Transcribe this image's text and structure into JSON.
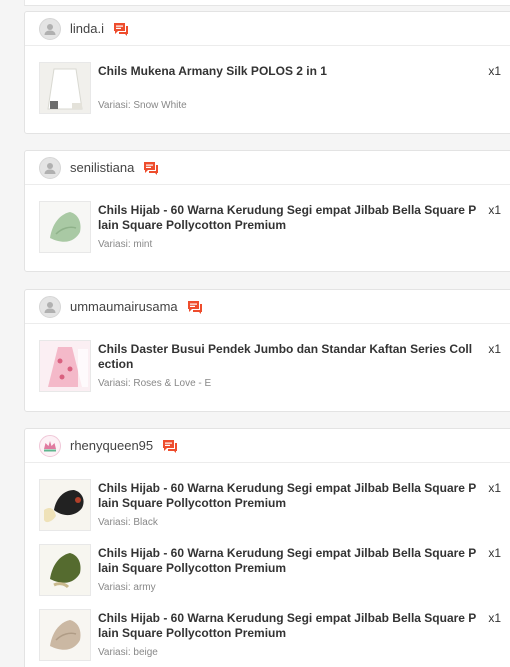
{
  "orders": [
    {
      "username": "linda.i",
      "items": [
        {
          "title": "Chils Mukena Armany Silk POLOS 2 in 1",
          "variant": "Variasi: Snow White",
          "qty": "x1"
        }
      ]
    },
    {
      "username": "senilistiana",
      "items": [
        {
          "title": "Chils Hijab - 60 Warna Kerudung Segi empat Jilbab Bella Square Plain Square Pollycotton Premium",
          "variant": "Variasi: mint",
          "qty": "x1"
        }
      ]
    },
    {
      "username": "ummaumairusama",
      "items": [
        {
          "title": "Chils Daster Busui Pendek Jumbo dan Standar Kaftan Series Collection",
          "variant": "Variasi: Roses & Love - E",
          "qty": "x1"
        }
      ]
    },
    {
      "username": "rhenyqueen95",
      "items": [
        {
          "title": "Chils Hijab - 60 Warna Kerudung Segi empat Jilbab Bella Square Plain Square Pollycotton Premium",
          "variant": "Variasi: Black",
          "qty": "x1"
        },
        {
          "title": "Chils Hijab - 60 Warna Kerudung Segi empat Jilbab Bella Square Plain Square Pollycotton Premium",
          "variant": "Variasi: army",
          "qty": "x1"
        },
        {
          "title": "Chils Hijab - 60 Warna Kerudung Segi empat Jilbab Bella Square Plain Square Pollycotton Premium",
          "variant": "Variasi: beige",
          "qty": "x1"
        }
      ]
    }
  ],
  "colors": {
    "accent": "#ee4d2d",
    "mint": "#a9c9a4",
    "black": "#222222",
    "army": "#556b2f",
    "beige": "#cbb8a3"
  }
}
